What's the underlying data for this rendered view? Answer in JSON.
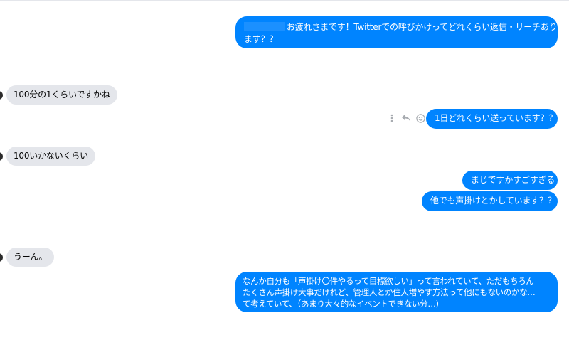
{
  "conversation": {
    "messages": [
      {
        "direction": "outgoing",
        "redacted_prefix": true,
        "lines": [
          "お疲れさまです！Twitterでの呼びかけってどれくらい返信・リーチあり",
          "ます？？"
        ]
      },
      {
        "direction": "incoming",
        "text": "100分の1くらいですかね"
      },
      {
        "direction": "outgoing",
        "text": "1日どれくらい送っています？？"
      },
      {
        "direction": "incoming",
        "text": "100いかないくらい"
      },
      {
        "direction": "outgoing",
        "text": "まじですかすごすぎる"
      },
      {
        "direction": "outgoing",
        "text": "他でも声掛けとかしています？？"
      },
      {
        "direction": "incoming",
        "text": "うーん。"
      },
      {
        "direction": "outgoing",
        "lines": [
          "なんか自分も「声掛け〇件やるって目標欲しい」って言われていて、ただもちろん",
          "たくさん声掛け大事だけれど、管理人とか住人増やす方法って他にもないのかな…",
          "て考えていて、（あまり大々的なイベントできない分…)"
        ]
      }
    ]
  },
  "message_actions": {
    "more_icon": "more-vertical-icon",
    "reply_icon": "reply-icon",
    "react_icon": "smiley-icon"
  },
  "colors": {
    "outgoing_bubble": "#0084ff",
    "incoming_bubble": "#e4e6eb",
    "avatar": "#2b2b2b"
  }
}
